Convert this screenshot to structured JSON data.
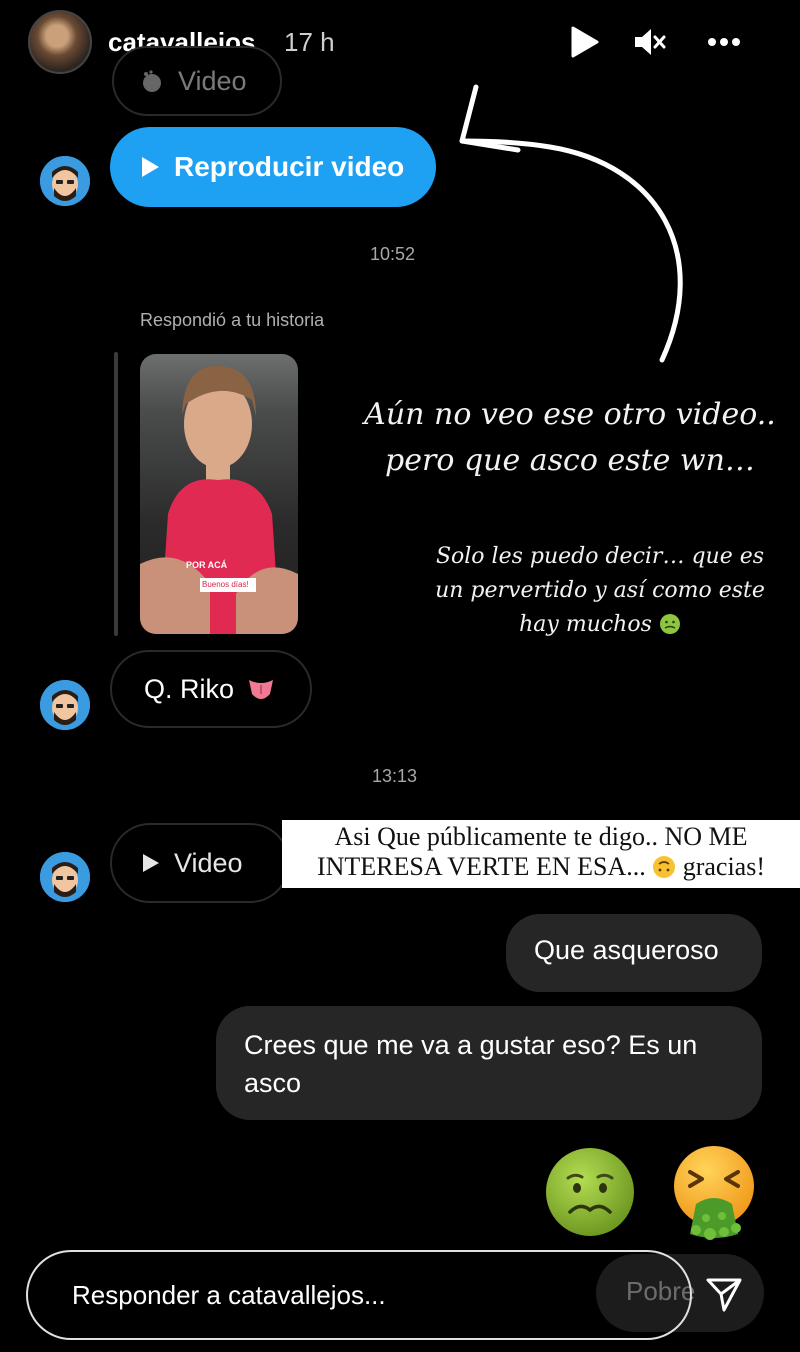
{
  "header": {
    "username": "catavallejos",
    "time": "17 h"
  },
  "messages": {
    "video_top_label": "Video",
    "play_video_label": "Reproducir video",
    "timestamp_1": "10:52",
    "reply_context": "Respondió a tu historia",
    "story_sticker_line1": "POR ACÁ",
    "story_sticker_line2": "Buenos días!",
    "riko_text": "Q. Riko",
    "timestamp_2": "13:13",
    "video_bottom_label": "Video",
    "bubble_1": "Que asqueroso",
    "bubble_2": "Crees que me va a gustar eso? Es un asco"
  },
  "overlays": {
    "script_1_line1": "Aún no veo ese otro video..",
    "script_1_line2": "pero que asco este wn…",
    "script_2_line1": "Solo les puedo decir… que es",
    "script_2_line2": "un pervertido y así como este",
    "script_2_line3": "hay muchos",
    "caption_line1": "Asi Que públicamente te digo.. NO ME",
    "caption_line2": "INTERESA VERTE EN ESA...",
    "caption_line2_end": "gracias!"
  },
  "reply": {
    "placeholder": "Responder a catavallejos...",
    "behind_text": "Pobre"
  },
  "colors": {
    "accent_blue": "#1ea1f3",
    "bubble_gray": "#262626",
    "background": "#000000"
  },
  "icons": [
    "play-icon",
    "mute-icon",
    "more-icon",
    "send-icon",
    "nauseated-face-emoji",
    "vomiting-face-emoji",
    "tongue-emoji",
    "upside-down-face-emoji"
  ]
}
